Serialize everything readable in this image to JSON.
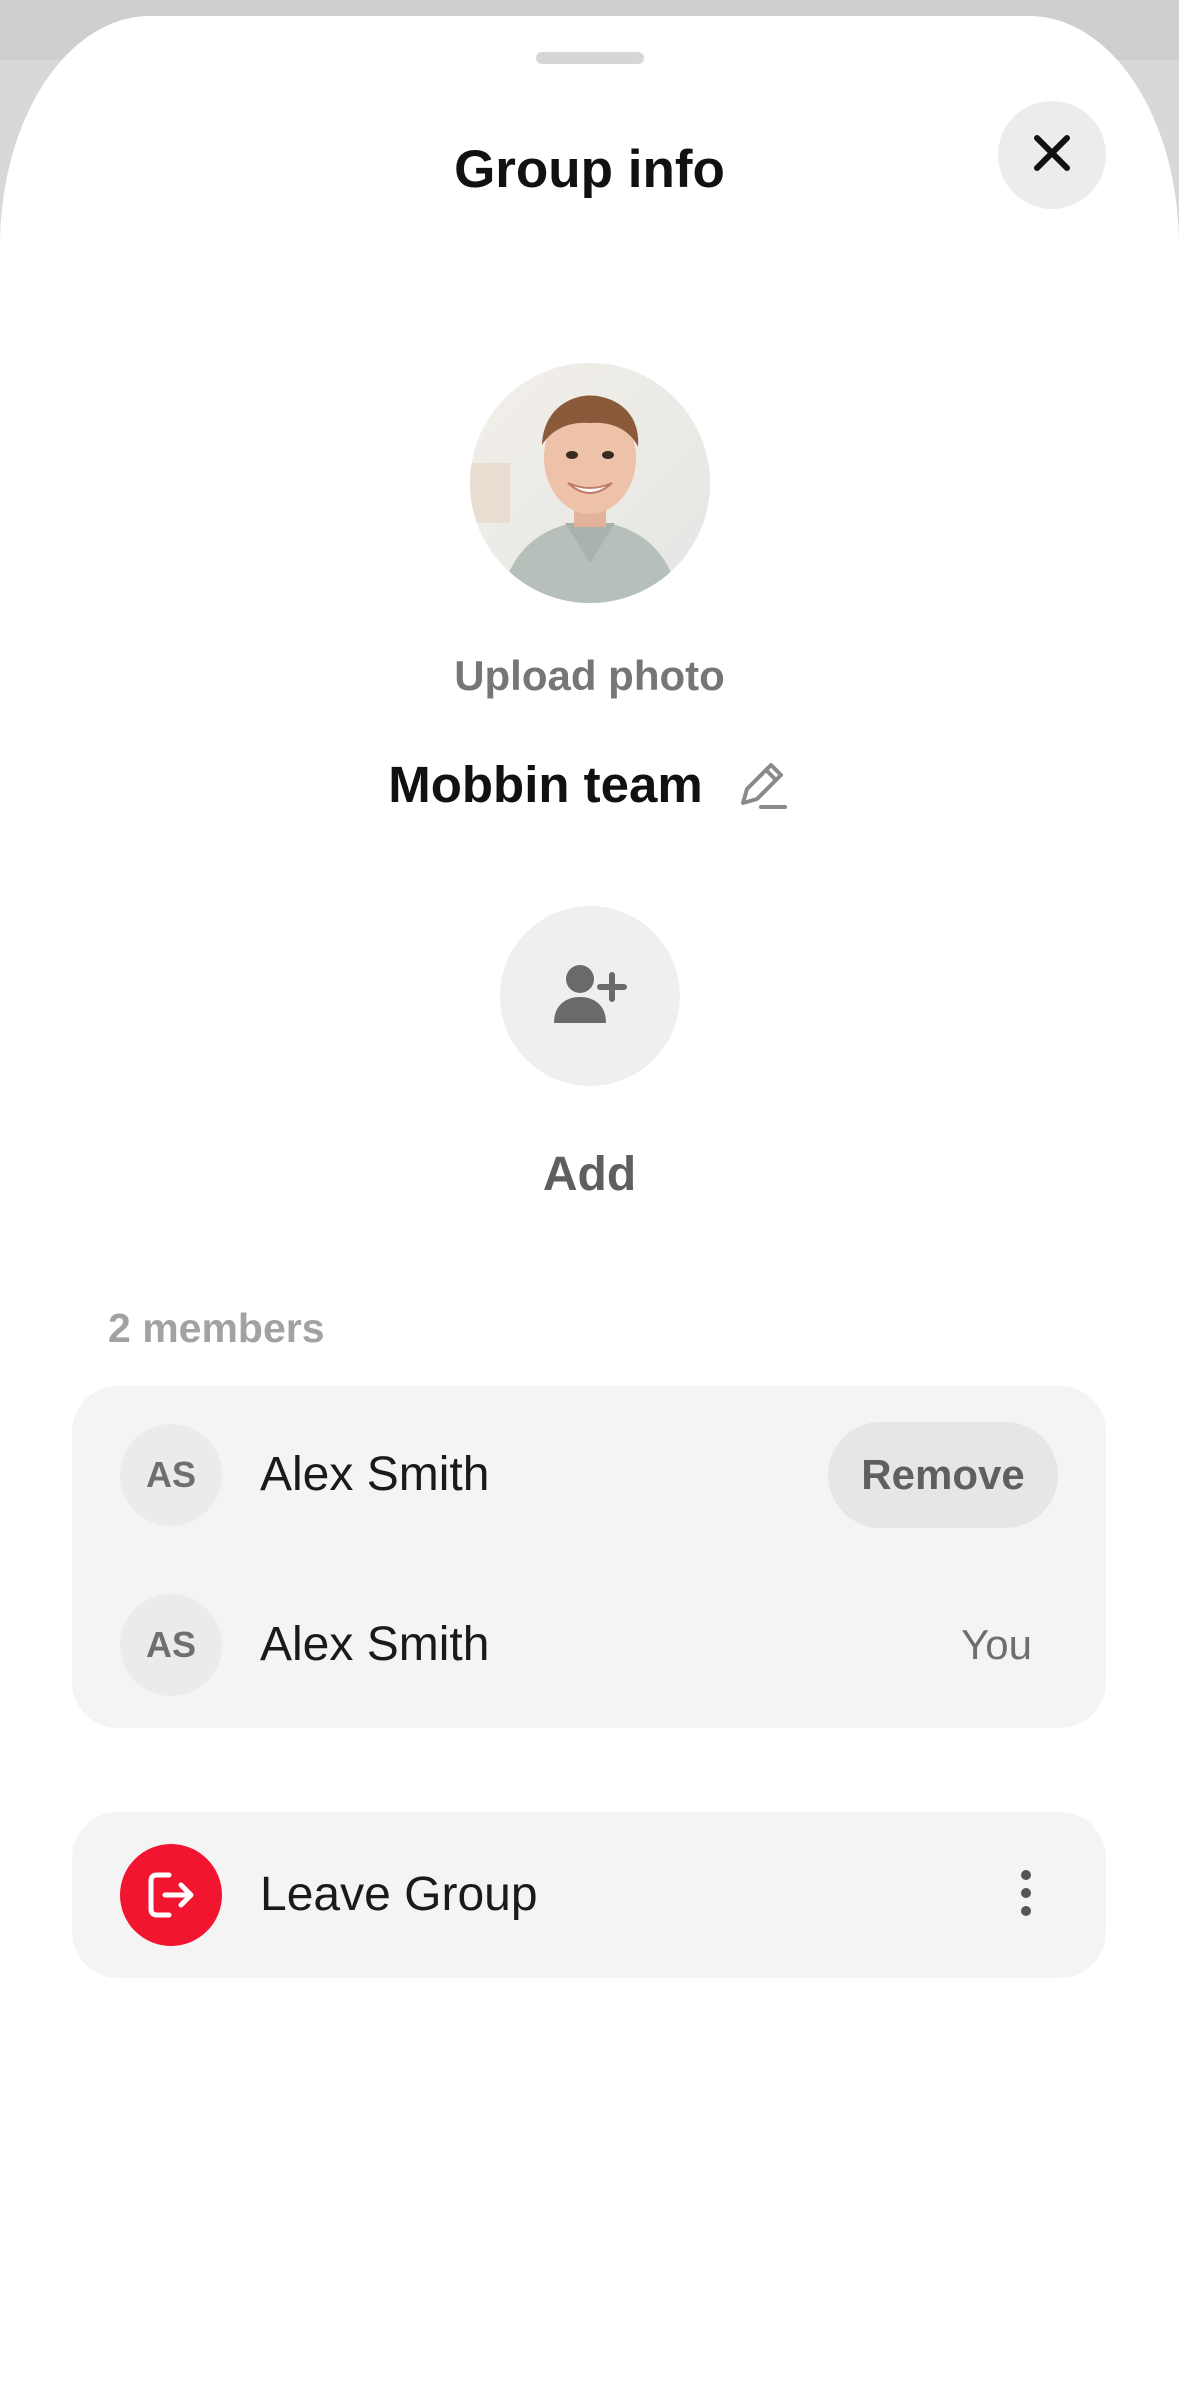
{
  "header": {
    "title": "Group info",
    "close_icon": "close-icon"
  },
  "group": {
    "photo_icon": "group-photo",
    "upload_label": "Upload photo",
    "name": "Mobbin team",
    "edit_icon": "pencil-icon"
  },
  "add": {
    "icon": "add-person-icon",
    "label": "Add"
  },
  "members": {
    "count_label": "2 members",
    "items": [
      {
        "initials": "AS",
        "name": "Alex Smith",
        "action_label": "Remove"
      },
      {
        "initials": "AS",
        "name": "Alex Smith",
        "tag": "You"
      }
    ]
  },
  "leave": {
    "icon": "leave-icon",
    "label": "Leave Group",
    "more_icon": "more-vertical-icon"
  },
  "colors": {
    "accent_red": "#f2152f",
    "card_bg": "#f4f4f4"
  }
}
